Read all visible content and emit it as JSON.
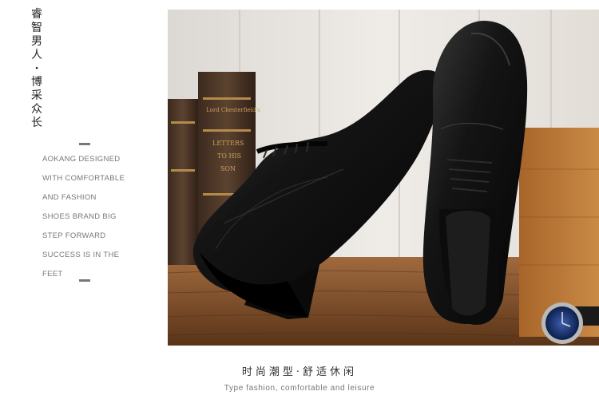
{
  "vertical_title": {
    "chars": [
      "睿",
      "智",
      "男",
      "人",
      "·",
      "博",
      "采",
      "众",
      "长"
    ]
  },
  "description": {
    "lines": [
      "AOKANG DESIGNED",
      "WITH COMFORTABLE",
      "AND FASHION",
      "SHOES BRAND BIG",
      "STEP FORWARD",
      "SUCCESS IS IN THE",
      "FEET"
    ]
  },
  "caption": {
    "chinese": "时尚潮型·舒适休闲",
    "english": "Type fashion, comfortable and leisure"
  },
  "colors": {
    "leather": "#141414",
    "wood": "#7a4a24",
    "background_wall": "#e9e6e2"
  },
  "book_spine_text": [
    "Lord Chesterfield's",
    "LETTERS",
    "TO HIS",
    "SON"
  ]
}
